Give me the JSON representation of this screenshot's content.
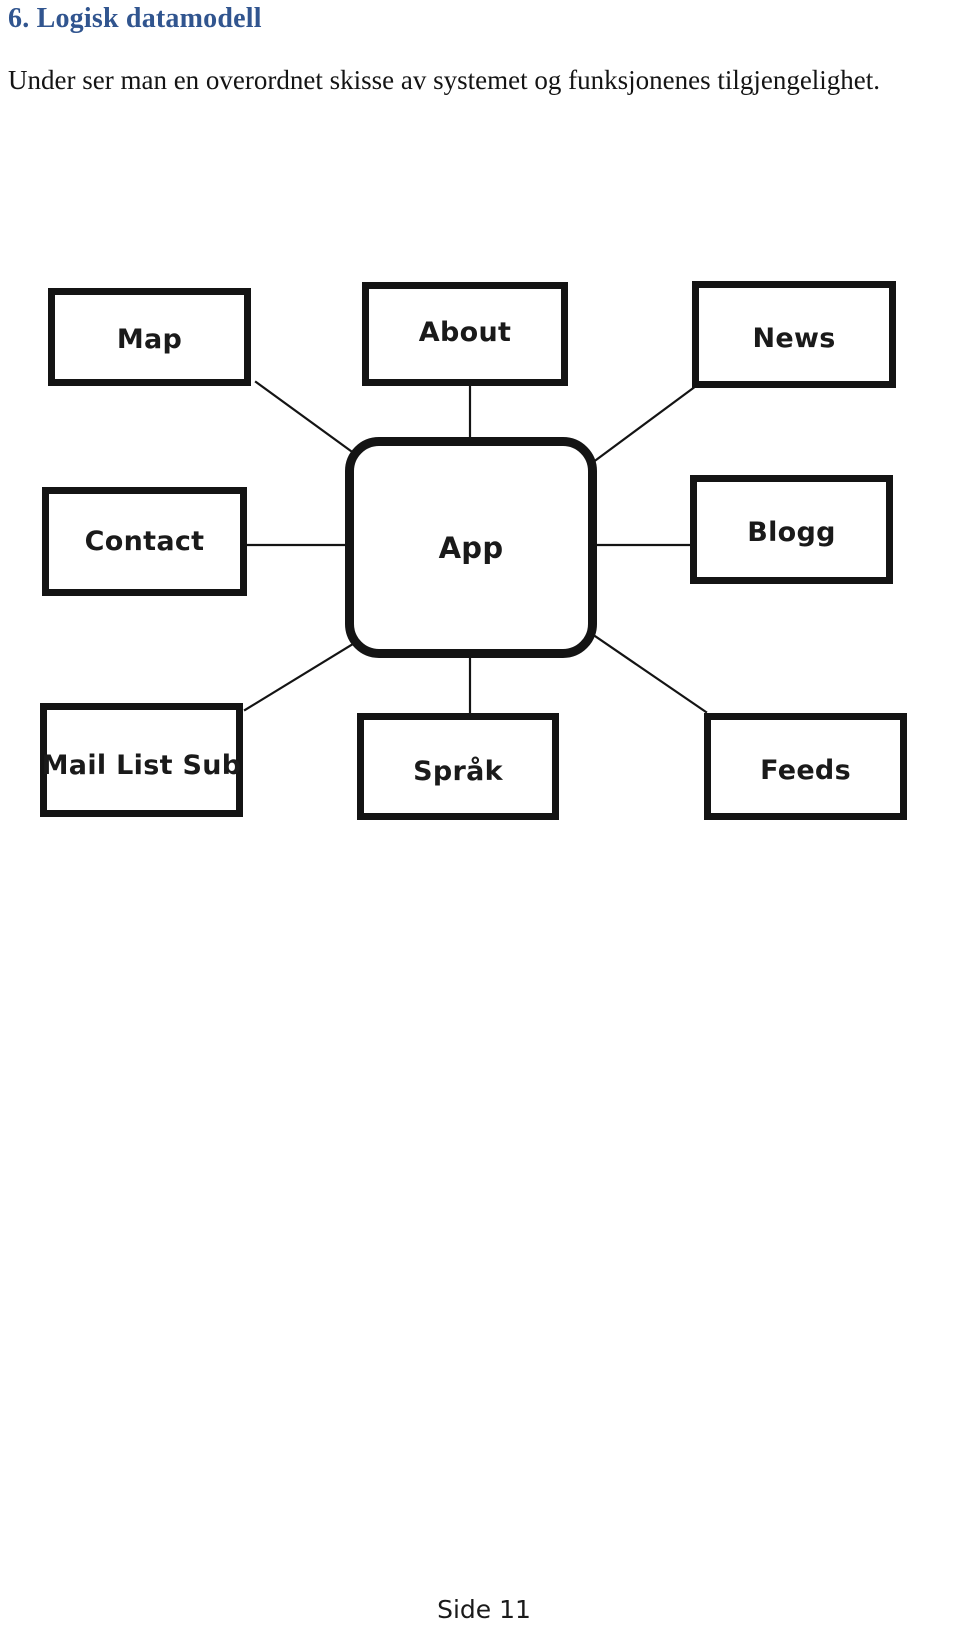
{
  "document": {
    "heading": "6. Logisk datamodell",
    "paragraph": "Under ser man en overordnet skisse av systemet og funksjonenes tilgjengelighet.",
    "footer_page_label": "Side 11",
    "heading_color": "#31558f",
    "text_color": "#141414",
    "line_color": "#141414",
    "background_color": "#ffffff"
  },
  "diagram": {
    "center": {
      "label": "App"
    },
    "nodes": [
      {
        "label": "Map"
      },
      {
        "label": "About"
      },
      {
        "label": "News"
      },
      {
        "label": "Contact"
      },
      {
        "label": "Blogg"
      },
      {
        "label": "Mail List Sub"
      },
      {
        "label": "Språk"
      },
      {
        "label": "Feeds"
      }
    ],
    "connections": [
      {
        "from": "Map",
        "to": "App"
      },
      {
        "from": "About",
        "to": "App"
      },
      {
        "from": "News",
        "to": "App"
      },
      {
        "from": "Contact",
        "to": "App"
      },
      {
        "from": "Blogg",
        "to": "App"
      },
      {
        "from": "Mail List Sub",
        "to": "App"
      },
      {
        "from": "Språk",
        "to": "App"
      },
      {
        "from": "Feeds",
        "to": "App"
      }
    ]
  }
}
